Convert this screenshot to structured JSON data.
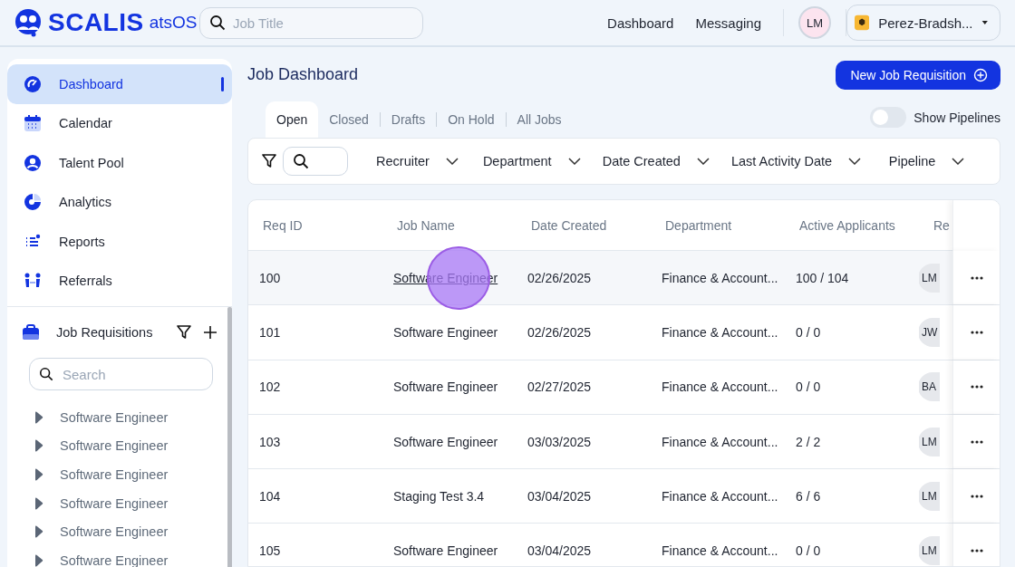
{
  "header": {
    "brand": "SCALIS",
    "product": "atsOS",
    "search": {
      "placeholder": "Job Title"
    },
    "nav": [
      "Dashboard",
      "Messaging"
    ],
    "user_initials": "LM",
    "company": "Perez-Bradsh..."
  },
  "sidebar": {
    "items": [
      {
        "label": "Dashboard",
        "selected": true
      },
      {
        "label": "Calendar",
        "selected": false
      },
      {
        "label": "Talent Pool",
        "selected": false
      },
      {
        "label": "Analytics",
        "selected": false
      },
      {
        "label": "Reports",
        "selected": false
      },
      {
        "label": "Referrals",
        "selected": false
      }
    ],
    "requisitions": {
      "title": "Job Requisitions",
      "search": {
        "placeholder": "Search"
      },
      "items": [
        "Software Engineer",
        "Software Engineer",
        "Software Engineer",
        "Software Engineer",
        "Software Engineer",
        "Software Engineer"
      ]
    }
  },
  "main": {
    "title": "Job Dashboard",
    "new_button": "New Job Requisition",
    "tabs": [
      {
        "label": "Open",
        "selected": true
      },
      {
        "label": "Closed",
        "selected": false
      },
      {
        "label": "Drafts",
        "selected": false
      },
      {
        "label": "On Hold",
        "selected": false
      },
      {
        "label": "All Jobs",
        "selected": false
      }
    ],
    "show_pipelines": {
      "label": "Show Pipelines",
      "on": false
    },
    "filters": [
      "Recruiter",
      "Department",
      "Date Created",
      "Last Activity Date",
      "Pipeline"
    ],
    "table": {
      "columns": [
        "Req ID",
        "Job Name",
        "Date Created",
        "Department",
        "Active Applicants",
        "Re"
      ],
      "rows": [
        {
          "id": "100",
          "job": "Software Engineer",
          "date": "02/26/2025",
          "department": "Finance & Account...",
          "applicants": "100 / 104",
          "recruiter": "LM",
          "hovered": true
        },
        {
          "id": "101",
          "job": "Software Engineer",
          "date": "02/26/2025",
          "department": "Finance & Account...",
          "applicants": "0 / 0",
          "recruiter": "JW",
          "hovered": false
        },
        {
          "id": "102",
          "job": "Software Engineer",
          "date": "02/27/2025",
          "department": "Finance & Account...",
          "applicants": "0 / 0",
          "recruiter": "BA",
          "hovered": false
        },
        {
          "id": "103",
          "job": "Software Engineer",
          "date": "03/03/2025",
          "department": "Finance & Account...",
          "applicants": "2 / 2",
          "recruiter": "LM",
          "hovered": false
        },
        {
          "id": "104",
          "job": "Staging Test 3.4",
          "date": "03/04/2025",
          "department": "Finance & Account...",
          "applicants": "6 / 6",
          "recruiter": "LM",
          "hovered": false
        },
        {
          "id": "105",
          "job": "Software Engineer",
          "date": "03/04/2025",
          "department": "Finance & Account...",
          "applicants": "0 / 0",
          "recruiter": "LM",
          "hovered": false
        }
      ]
    }
  }
}
